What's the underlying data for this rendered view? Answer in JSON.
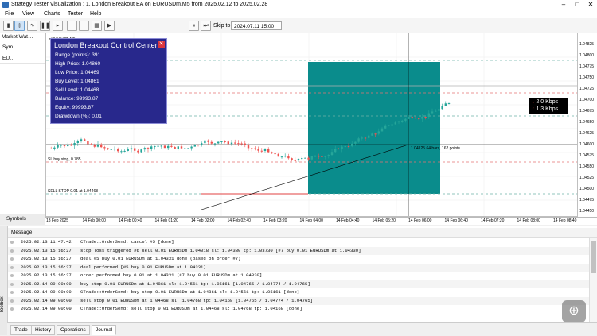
{
  "window": {
    "title": "Strategy Tester Visualization : 1. London Breakout EA on EURUSDm,M5 from 2025.02.12 to 2025.02.28",
    "controls": [
      "–",
      "□",
      "✕"
    ]
  },
  "menu": [
    "File",
    "View",
    "Charts",
    "Tester",
    "Help"
  ],
  "toolbar": {
    "skip_label": "Skip to",
    "skip_date": "2024.07.11 15:00"
  },
  "navigator": {
    "header": "Market Wat…",
    "rows": [
      "Sym…",
      "EU…"
    ],
    "symbols_tab": "Symbols"
  },
  "chart": {
    "symbol_header": "EURUSDm,M5",
    "sl_label": "SL buy stop, 0.785",
    "sell_label": "SELL STOP 0.01 at 1.04468",
    "crosshair_label": "1.04125 64 bars, 162 points"
  },
  "control_center": {
    "title": "London Breakout Control Center",
    "lines": [
      "Range (points): 391",
      "High Price: 1.04860",
      "Low Price: 1.04469",
      "Buy Level: 1.04861",
      "Sell Level: 1.04468",
      "Balance: 99993.87",
      "Equity: 99993.87",
      "Drawdown (%): 0.01"
    ]
  },
  "network": {
    "down": "2.0 Kbps",
    "up": "1.3 Kbps"
  },
  "price_scale": [
    "1.04825",
    "1.04800",
    "1.04775",
    "1.04750",
    "1.04725",
    "1.04700",
    "1.04675",
    "1.04650",
    "1.04625",
    "1.04600",
    "1.04575",
    "1.04550",
    "1.04525",
    "1.04500",
    "1.04475",
    "1.04450"
  ],
  "time_scale": [
    "13 Feb 2025",
    "14 Feb 00:00",
    "14 Feb 00:40",
    "14 Feb 01:20",
    "14 Feb 02:00",
    "14 Feb 02:40",
    "14 Feb 03:20",
    "14 Feb 04:00",
    "14 Feb 04:40",
    "14 Feb 05:20",
    "14 Feb 06:00",
    "14 Feb 06:40",
    "14 Feb 07:20",
    "14 Feb 08:00",
    "14 Feb 08:40"
  ],
  "toolbox": {
    "side_label": "Toolbox",
    "message_header": "Message",
    "tabs": [
      "Trade",
      "History",
      "Operations",
      "Journal"
    ],
    "active_tab": "Journal",
    "log": [
      {
        "time": "2025.02.13 11:47:42",
        "text": "CTrade::OrderSend: cancel #5 [done]"
      },
      {
        "time": "2025.02.13 15:16:27",
        "text": "stop loss triggered #6 sell 0.01 EURUSDm 1.04018 sl: 1.04330 tp: 1.03730 [#7 buy 0.01 EURUSDm at 1.04330]"
      },
      {
        "time": "2025.02.13 15:16:27",
        "text": "deal #5 buy 0.01 EURUSDm at 1.04331 done (based on order #7)"
      },
      {
        "time": "2025.02.13 15:16:27",
        "text": "deal performed [#5 buy 0.01 EURUSDm at 1.04331]"
      },
      {
        "time": "2025.02.13 15:16:27",
        "text": "order performed buy 0.01 at 1.04331 [#7 buy 0.01 EURUSDm at 1.04330]"
      },
      {
        "time": "2025.02.14 09:00:00",
        "text": "buy stop 0.01 EURUSDm at 1.04861 sl: 1.04561 tp: 1.05161 [1.04765 / 1.04774 / 1.04765]"
      },
      {
        "time": "2025.02.14 09:00:00",
        "text": "CTrade::OrderSend: buy stop 0.01 EURUSDm at 1.04861 sl: 1.04561 tp: 1.05161 [done]"
      },
      {
        "time": "2025.02.14 09:00:00",
        "text": "sell stop 0.01 EURUSDm at 1.04468 sl: 1.04768 tp: 1.04168 [1.04765 / 1.04774 / 1.04765]"
      },
      {
        "time": "2025.02.14 09:00:00",
        "text": "CTrade::OrderSend: sell stop 0.01 EURUSDm at 1.04468 sl: 1.04768 tp: 1.04168 [done]"
      }
    ]
  },
  "colors": {
    "panel_bg": "#28288c",
    "range_box": "#0a8c8c",
    "bull_candle": "#26a69a",
    "bear_candle": "#ef5350"
  }
}
